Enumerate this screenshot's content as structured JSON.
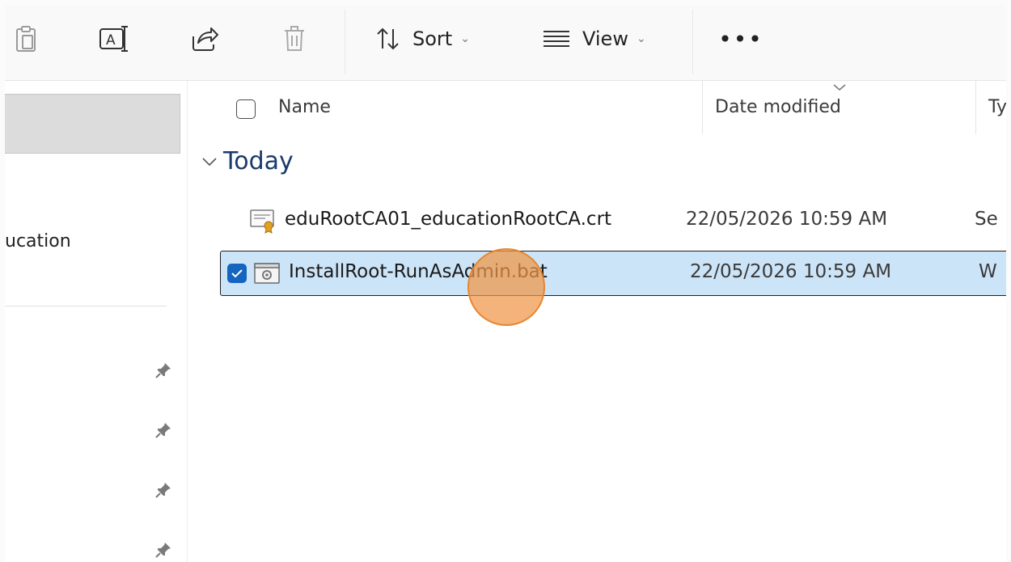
{
  "toolbar": {
    "buttons": [
      {
        "icon": "paste-icon"
      },
      {
        "icon": "rename-icon"
      },
      {
        "icon": "share-icon"
      },
      {
        "icon": "delete-icon"
      }
    ],
    "sort_label": "Sort",
    "view_label": "View",
    "more_label": "•••"
  },
  "nav": {
    "visible_label": "ucation",
    "pins": [
      "pin-icon",
      "pin-icon",
      "pin-icon",
      "pin-icon"
    ]
  },
  "columns": {
    "name": "Name",
    "date_modified": "Date modified",
    "type": "Ty"
  },
  "group": {
    "label": "Today"
  },
  "files": [
    {
      "name": "eduRootCA01_educationRootCA.crt",
      "date_modified": "22/05/2026 10:59 AM",
      "type": "Se",
      "icon": "certificate-file-icon",
      "selected": false
    },
    {
      "name": "InstallRoot-RunAsAdmin.bat",
      "date_modified": "22/05/2026 10:59 AM",
      "type": "W",
      "icon": "batch-file-icon",
      "selected": true
    }
  ],
  "colors": {
    "selection_fill": "#cce4f7",
    "checkbox_accent": "#1565c0",
    "group_header": "#1b3a6b",
    "click_marker": "#f0964a"
  }
}
